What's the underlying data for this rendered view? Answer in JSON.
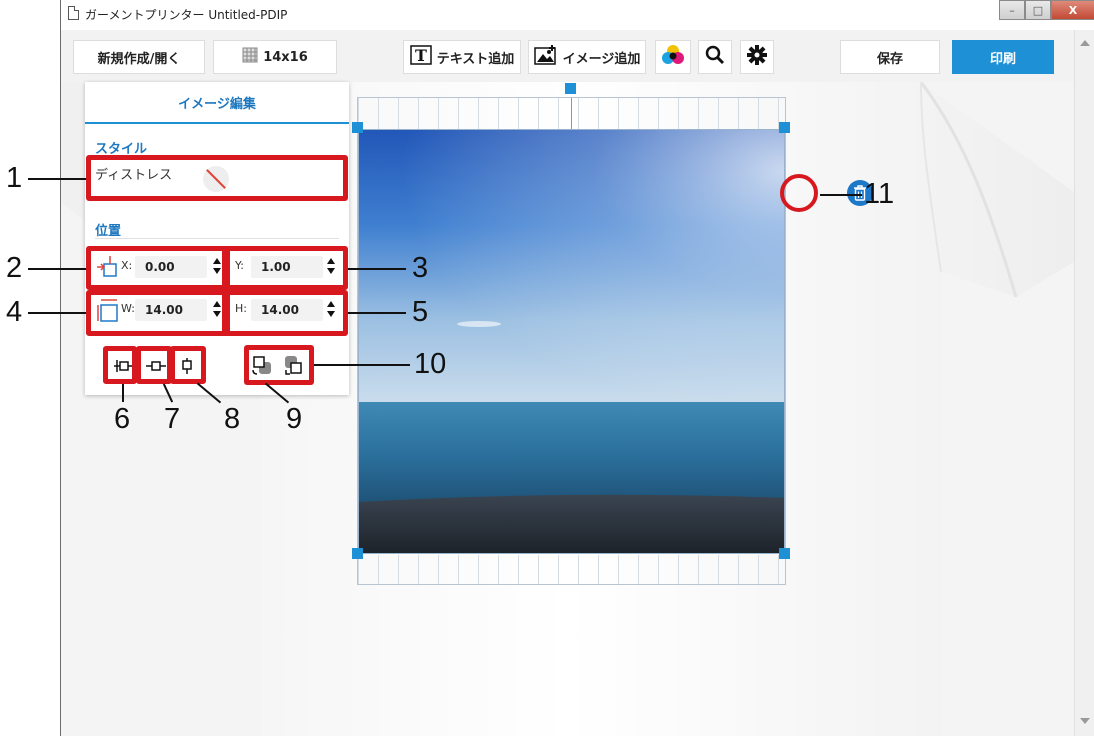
{
  "window": {
    "title": "ガーメントプリンター Untitled-PDIP",
    "controls": [
      "–",
      "□",
      "X"
    ]
  },
  "toolbar": {
    "new_open_label": "新規作成/開く",
    "platen_size_label": "14x16",
    "add_text_label": "テキスト追加",
    "add_image_label": "イメージ追加",
    "save_label": "保存",
    "print_label": "印刷"
  },
  "panel": {
    "title": "イメージ編集",
    "style_section": "スタイル",
    "style_value": "ディストレス",
    "position_section": "位置",
    "x_label": "X:",
    "x_value": "0.00",
    "y_label": "Y:",
    "y_value": "1.00",
    "w_label": "W:",
    "w_value": "14.00",
    "h_label": "H:",
    "h_value": "14.00"
  },
  "callouts": [
    "1",
    "2",
    "3",
    "4",
    "5",
    "6",
    "7",
    "8",
    "9",
    "10",
    "11"
  ],
  "colors": {
    "accent": "#1e90d6",
    "callout": "#d7191f"
  },
  "icons": {
    "platen": "platen-icon",
    "text": "text-add-icon",
    "image": "image-add-icon",
    "color": "color-balls-icon",
    "zoom": "search-icon",
    "settings": "gear-icon",
    "trash": "trash-icon"
  }
}
